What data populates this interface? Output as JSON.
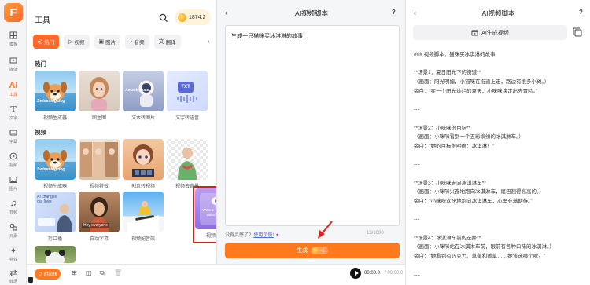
{
  "rail": {
    "logo": "F",
    "items": [
      {
        "icon": "template-icon",
        "label": "模板"
      },
      {
        "icon": "media-icon",
        "label": "媒体"
      },
      {
        "icon": "ai-tools-icon",
        "label": "工具"
      },
      {
        "icon": "text-icon",
        "label": "文字"
      },
      {
        "icon": "subtitle-icon",
        "label": "字幕"
      },
      {
        "icon": "video-icon",
        "label": "视频"
      },
      {
        "icon": "image-icon",
        "label": "图片"
      },
      {
        "icon": "music-icon",
        "label": "音频"
      },
      {
        "icon": "element-icon",
        "label": "元素"
      },
      {
        "icon": "effect-icon",
        "label": "特效"
      },
      {
        "icon": "transition-icon",
        "label": "转场"
      }
    ]
  },
  "tools": {
    "title": "工具",
    "coins": "1874.2",
    "tabs": [
      {
        "label": "热门",
        "icon": "fire-icon",
        "glyph": "◎"
      },
      {
        "label": "视频",
        "icon": "video-icon",
        "glyph": "▷"
      },
      {
        "label": "图片",
        "icon": "image-icon",
        "glyph": "▣"
      },
      {
        "label": "音频",
        "icon": "audio-icon",
        "glyph": "♪"
      },
      {
        "label": "翻译",
        "icon": "translate-icon",
        "glyph": "文"
      }
    ],
    "section_hot": "热门",
    "section_video": "视频",
    "hot_cards": [
      {
        "label": "视频生成器",
        "caption": "Swimming dog"
      },
      {
        "label": "图生图",
        "caption": ""
      },
      {
        "label": "文本转图片",
        "caption": "An astronaut..."
      },
      {
        "label": "文字转语音",
        "caption": "TXT"
      }
    ],
    "video_cards": [
      {
        "label": "视频生成器",
        "caption": "Swimming dog"
      },
      {
        "label": "视频特效",
        "caption": ""
      },
      {
        "label": "创意转视频",
        "caption": ""
      },
      {
        "label": "视频去背景",
        "caption": ""
      },
      {
        "label": "剪口播",
        "caption": "AI changes our lives"
      },
      {
        "label": "自动字幕",
        "caption": "Hey everyone"
      },
      {
        "label": "视频配音效",
        "caption": ""
      },
      {
        "label": "视频脚本",
        "caption": "Write a YouTube video script"
      }
    ]
  },
  "editor": {
    "back": "‹",
    "title": "AI视频脚本",
    "help": "?",
    "prompt_text": "生成一只猫咪买冰淇淋的故事",
    "hint": "没有灵感了?",
    "hint_link": "使用示例!",
    "count": "13/1000",
    "generate_label": "生成",
    "generate_cost": "-1"
  },
  "timeline": {
    "pill": "时间线",
    "current_time": "00:00.0",
    "total_time": "/ 00:00.0"
  },
  "result": {
    "back": "‹",
    "title": "AI视频脚本",
    "help": "?",
    "video_button": "AI生成视频",
    "lines": [
      "### 视频脚本：猫咪买冰淇淋的故事",
      "",
      "**场景1：夏日阳光下的街道**",
      "（画面：阳光明媚，小猫咪在街道上走，路边有很多小摊。）",
      "旁白：“在一个阳光灿烂的夏天，小咪咪决定出去冒险。”",
      "",
      "---",
      "",
      "**场景2：小咪咪的目标**",
      "（画面：小咪咪看到一个五彩缤纷的冰淇淋车。）",
      "旁白：“她的目标很明确：冰淇淋！”",
      "",
      "---",
      "",
      "**场景3：小咪咪走向冰淇淋车**",
      "（画面：小咪咪兴奋地跑向冰淇淋车，尾巴翘得高高的。）",
      "旁白：“小咪咪欢快地跑向冰淇淋车，心里充满期待。”",
      "",
      "---",
      "",
      "**场景4：冰淇淋车前的选择**",
      "（画面：小咪咪站在冰淇淋车前，眼前有各种口味的冰淇淋。）",
      "旁白：“她看到有巧克力、草莓和香草……她该选哪个呢？”",
      "",
      "---"
    ]
  }
}
